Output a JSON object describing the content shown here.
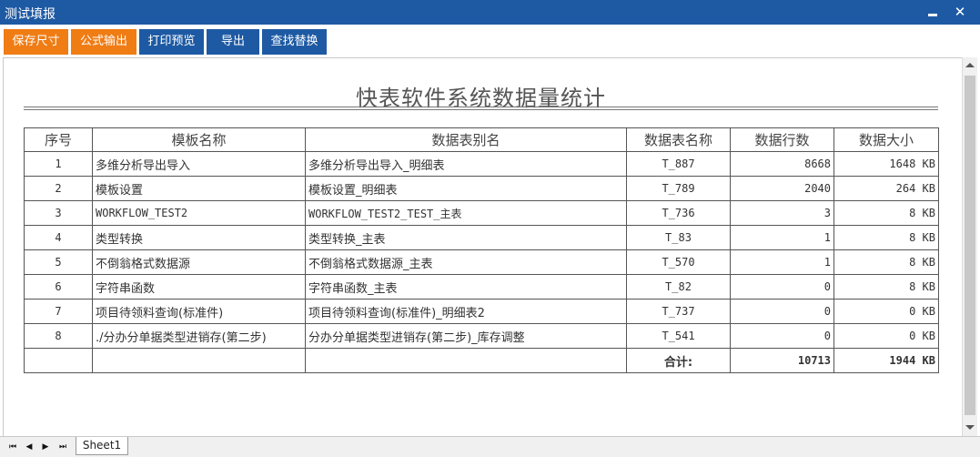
{
  "window": {
    "title": "测试填报",
    "minimize_glyph": "",
    "close_glyph": "✕"
  },
  "toolbar": {
    "save_size": "保存尺寸",
    "formula_output": "公式输出",
    "print_preview": "打印预览",
    "export": "导出",
    "find_replace": "查找替换",
    "colors": {
      "orange": "#f07c14",
      "blue": "#1e5aa3"
    }
  },
  "report": {
    "title": "快表软件系统数据量统计",
    "columns": [
      "序号",
      "模板名称",
      "数据表别名",
      "数据表名称",
      "数据行数",
      "数据大小"
    ],
    "rows": [
      {
        "no": "1",
        "template": "多维分析导出导入",
        "alias": "多维分析导出导入_明细表",
        "table": "T_887",
        "rows": "8668",
        "size": "1648 KB"
      },
      {
        "no": "2",
        "template": "模板设置",
        "alias": "模板设置_明细表",
        "table": "T_789",
        "rows": "2040",
        "size": "264 KB"
      },
      {
        "no": "3",
        "template": "WORKFLOW_TEST2",
        "alias": "WORKFLOW_TEST2_TEST_主表",
        "table": "T_736",
        "rows": "3",
        "size": "8 KB"
      },
      {
        "no": "4",
        "template": "类型转换",
        "alias": "类型转换_主表",
        "table": "T_83",
        "rows": "1",
        "size": "8 KB"
      },
      {
        "no": "5",
        "template": "不倒翁格式数据源",
        "alias": "不倒翁格式数据源_主表",
        "table": "T_570",
        "rows": "1",
        "size": "8 KB"
      },
      {
        "no": "6",
        "template": "字符串函数",
        "alias": "字符串函数_主表",
        "table": "T_82",
        "rows": "0",
        "size": "8 KB"
      },
      {
        "no": "7",
        "template": "项目待领料查询(标准件)",
        "alias": "项目待领料查询(标准件)_明细表2",
        "table": "T_737",
        "rows": "0",
        "size": "0 KB"
      },
      {
        "no": "8",
        "template": "./分办分单据类型进销存(第二步)",
        "alias": "分办分单据类型进销存(第二步)_库存调整",
        "table": "T_541",
        "rows": "0",
        "size": "0 KB"
      }
    ],
    "total_label": "合计:",
    "total_rows": "10713",
    "total_size": "1944 KB"
  },
  "sheet_tabs": {
    "nav_first": "⏮",
    "nav_prev": "◀",
    "nav_next": "▶",
    "nav_last": "⏭",
    "active": "Sheet1"
  }
}
